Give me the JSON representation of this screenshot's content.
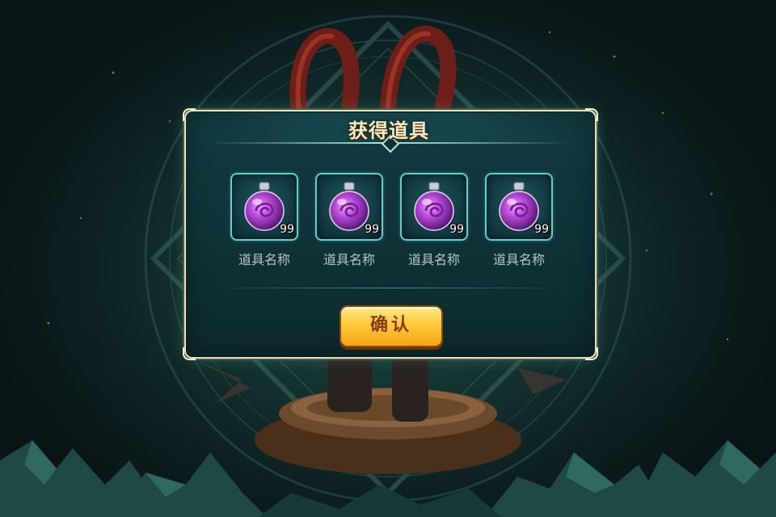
{
  "dialog": {
    "title": "获得道具",
    "confirm_label": "确认"
  },
  "items": [
    {
      "name": "道具名称",
      "count": "99",
      "icon": "purple-potion-icon"
    },
    {
      "name": "道具名称",
      "count": "99",
      "icon": "purple-potion-icon"
    },
    {
      "name": "道具名称",
      "count": "99",
      "icon": "purple-potion-icon"
    },
    {
      "name": "道具名称",
      "count": "99",
      "icon": "purple-potion-icon"
    }
  ],
  "colors": {
    "dialog_bg": "#0f3237",
    "dialog_border": "#e8e2b8",
    "slot_border": "#5fd0cf",
    "title_text": "#f7e9c2",
    "item_name_text": "#b7c6c4",
    "button_gold": "#ffc93a",
    "button_text": "#8a3a0c",
    "potion_purple": "#b84ad8"
  }
}
